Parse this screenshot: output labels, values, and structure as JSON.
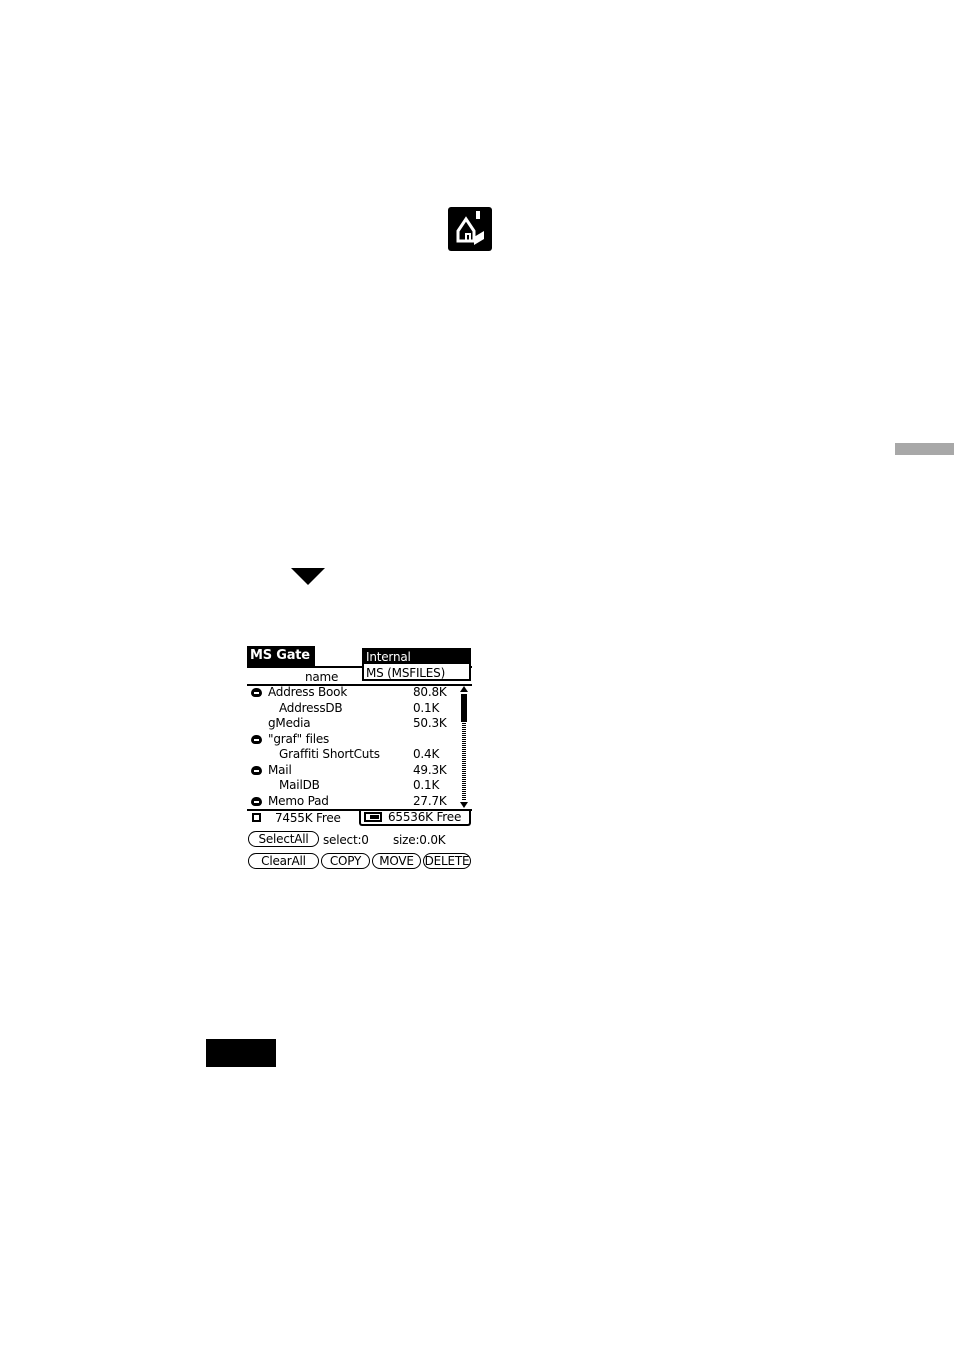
{
  "app": {
    "title": "MS Gate"
  },
  "location_menu": {
    "options": [
      "Internal",
      "MS (MSFILES)"
    ],
    "selected": "Internal"
  },
  "list": {
    "column_name": "name",
    "rows": [
      {
        "name": "Address Book",
        "size": "80.8K",
        "icon": "card-icon"
      },
      {
        "name": "AddressDB",
        "size": "0.1K",
        "icon": ""
      },
      {
        "name": "gMedia",
        "size": "50.3K",
        "icon": ""
      },
      {
        "name": "\"graf\" files",
        "size": "",
        "icon": "card-icon"
      },
      {
        "name": "Graffiti ShortCuts",
        "size": "0.4K",
        "icon": ""
      },
      {
        "name": "Mail",
        "size": "49.3K",
        "icon": "card-icon"
      },
      {
        "name": "MailDB",
        "size": "0.1K",
        "icon": ""
      },
      {
        "name": "Memo Pad",
        "size": "27.7K",
        "icon": "card-icon"
      }
    ]
  },
  "free_space": {
    "internal": "7455K Free",
    "card": "65536K Free"
  },
  "selection": {
    "select_all_label": "SelectAll",
    "select_count": "select:0",
    "size": "size:0.0K"
  },
  "actions": {
    "clear_all_label": "ClearAll",
    "copy_label": "COPY",
    "move_label": "MOVE",
    "delete_label": "DELETE"
  }
}
